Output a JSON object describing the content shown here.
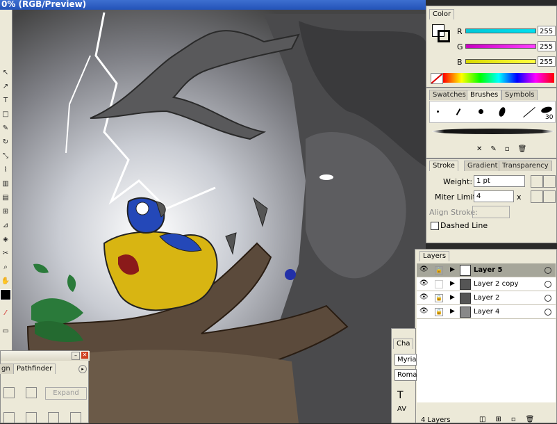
{
  "window": {
    "title": "0% (RGB/Preview)"
  },
  "color_panel": {
    "tab": "Color",
    "channels": [
      {
        "label": "R",
        "value": "255",
        "color": "#00b7d8"
      },
      {
        "label": "G",
        "value": "255",
        "color": "#d800c8"
      },
      {
        "label": "B",
        "value": "255",
        "color": "#e6e600"
      }
    ]
  },
  "brushes_panel": {
    "tabs": [
      "Swatches",
      "Brushes",
      "Symbols"
    ],
    "active": "Brushes",
    "size_label": "30"
  },
  "stroke_panel": {
    "tabs": [
      "Stroke",
      "Gradient",
      "Transparency"
    ],
    "weight_label": "Weight:",
    "weight_value": "1 pt",
    "miter_label": "Miter Limit:",
    "miter_value": "4",
    "miter_unit": "x",
    "align_label": "Align Stroke:",
    "dashed_label": "Dashed Line"
  },
  "layers_panel": {
    "tab": "Layers",
    "layers": [
      {
        "name": "Layer 5",
        "selected": true
      },
      {
        "name": "Layer 2 copy",
        "selected": false
      },
      {
        "name": "Layer 2",
        "selected": false
      },
      {
        "name": "Layer 4",
        "selected": false
      }
    ],
    "footer": "4 Layers"
  },
  "pathfinder_panel": {
    "tabs": [
      "gn",
      "Pathfinder"
    ],
    "expand_label": "Expand"
  },
  "character_panel": {
    "tab": "Cha",
    "font_family": "Myria",
    "font_style": "Roma"
  }
}
